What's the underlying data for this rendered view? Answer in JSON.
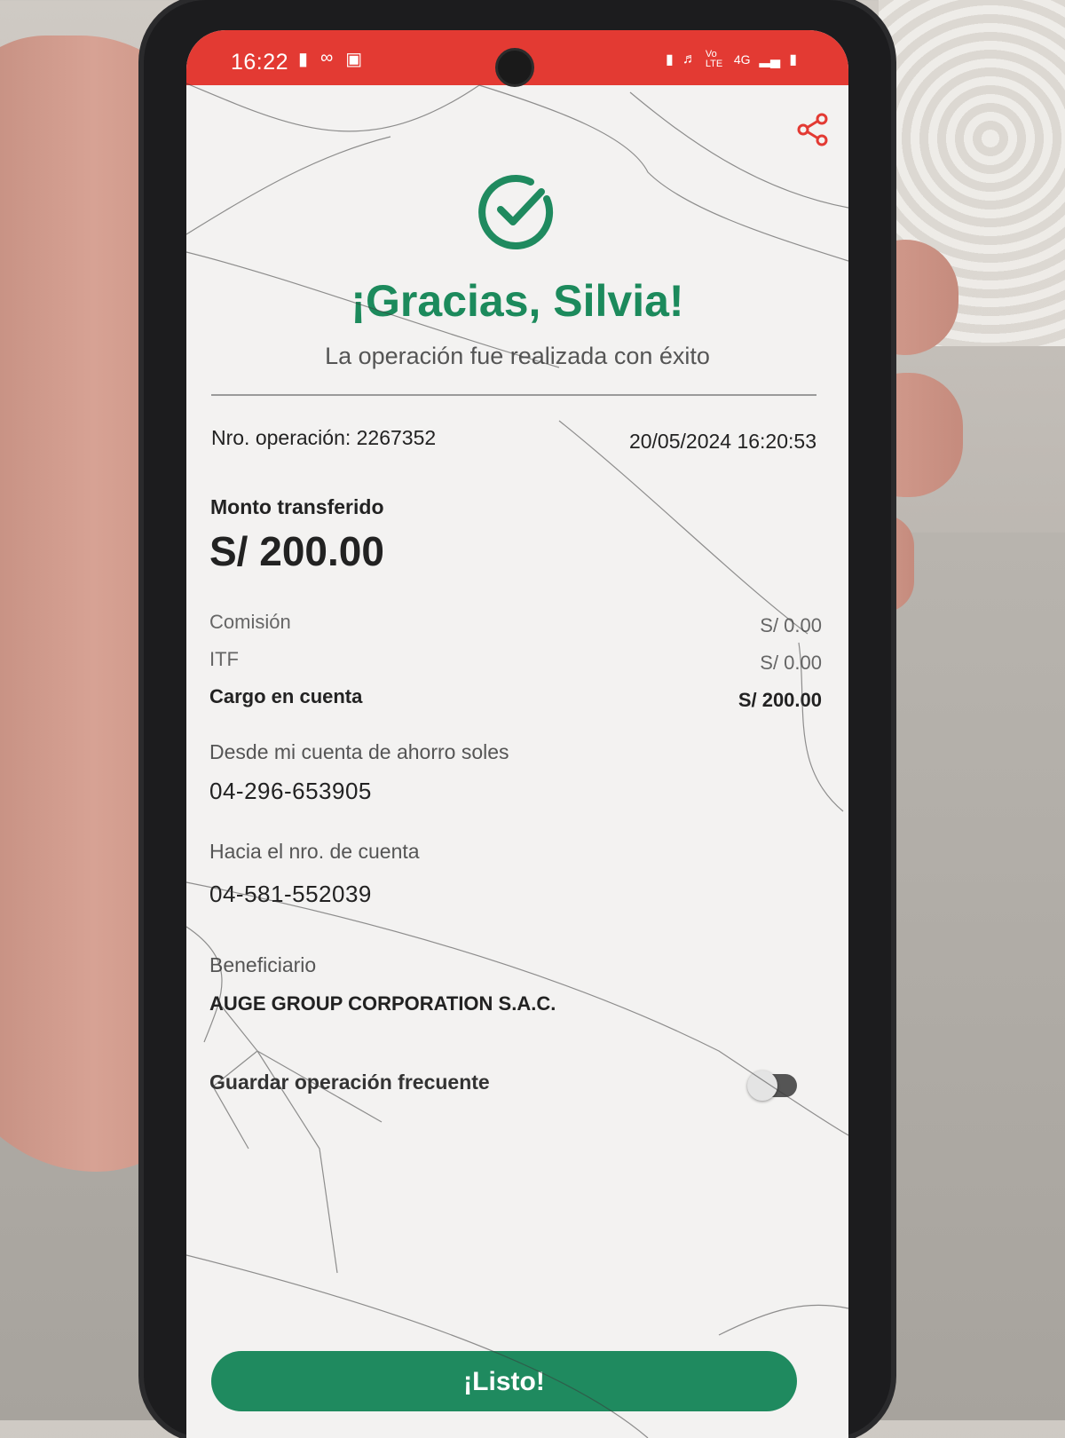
{
  "status_bar": {
    "time": "16:22",
    "left_icons": [
      "message-icon",
      "voicemail-icon",
      "record-icon"
    ],
    "right_icons": [
      "battery-saver-icon",
      "mute-icon",
      "volte-icon",
      "4g-icon",
      "signal-icon",
      "battery-icon"
    ],
    "right_text": [
      "Vo LTE",
      "4G"
    ]
  },
  "theme": {
    "status_bar_color": "#e33a33",
    "accent_green": "#1f8a5f"
  },
  "header": {
    "greeting": "¡Gracias, Silvia!",
    "subtitle": "La operación fue realizada con éxito"
  },
  "operation": {
    "number_label": "Nro. operación: 2267352",
    "datetime": "20/05/2024 16:20:53"
  },
  "amount": {
    "label": "Monto transferido",
    "value": "S/ 200.00"
  },
  "charges": [
    {
      "label": "Comisión",
      "value": "S/ 0.00"
    },
    {
      "label": "ITF",
      "value": "S/ 0.00"
    },
    {
      "label": "Cargo en cuenta",
      "value": "S/ 200.00"
    }
  ],
  "from_account": {
    "label": "Desde mi cuenta de ahorro soles",
    "value": "04-296-653905"
  },
  "to_account": {
    "label": "Hacia el nro. de cuenta",
    "value": "04-581-552039"
  },
  "beneficiary": {
    "label": "Beneficiario",
    "value": "AUGE GROUP CORPORATION S.A.C."
  },
  "save_frequent": {
    "label": "Guardar operación frecuente",
    "enabled": false
  },
  "done_button": {
    "label": "¡Listo!"
  }
}
